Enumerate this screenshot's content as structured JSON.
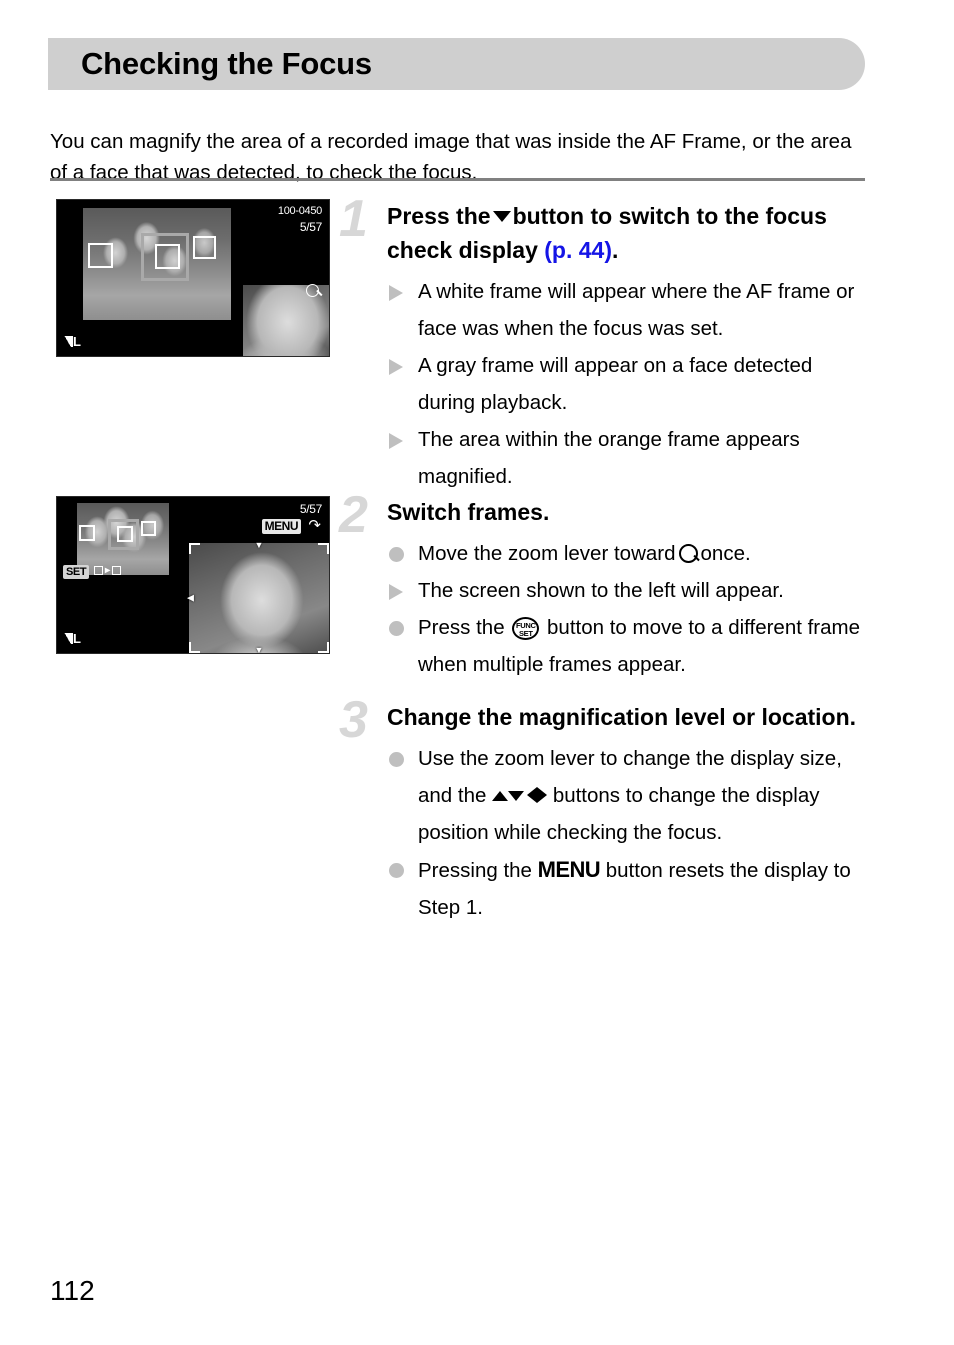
{
  "header": {
    "title": "Checking the Focus",
    "bar_color": "#cfcfcf"
  },
  "intro": {
    "text": "You can magnify the area of a recorded image that was inside the AF Frame, or the area of a face that was detected, to check the focus."
  },
  "figures": {
    "screen1": {
      "file_number": "100-0450",
      "frame_count": "5/57",
      "quality_label": "L",
      "magnify_icon": "magnifier-icon"
    },
    "screen2": {
      "frame_count": "5/57",
      "menu_badge": "MENU",
      "return_icon": "return-arrow-icon",
      "set_badge": "SET",
      "set_action_icon": "frame-to-frame-icon",
      "quality_label": "L"
    }
  },
  "steps": [
    {
      "number": "1",
      "heading_before": "Press the",
      "heading_glyph": "down-arrow-button",
      "heading_mid": "button to switch to the focus check display",
      "heading_link": "(p. 44)",
      "heading_after": ".",
      "bullets": [
        {
          "marker": "triangle",
          "text": "A white frame will appear where the AF frame or face was when the focus was set."
        },
        {
          "marker": "triangle",
          "text": "A gray frame will appear on a face detected during playback."
        },
        {
          "marker": "triangle",
          "text": "The area within the orange frame appears magnified."
        }
      ]
    },
    {
      "number": "2",
      "heading": "Switch frames.",
      "bullets": [
        {
          "marker": "dot",
          "before": "Move the zoom lever toward",
          "glyph": "magnifier-icon",
          "after": "once."
        },
        {
          "marker": "triangle",
          "text": "The screen shown to the left will appear."
        },
        {
          "marker": "dot",
          "before": "Press the",
          "glyph": "func-set-button",
          "after": "button to move to a different frame when multiple frames appear."
        }
      ]
    },
    {
      "number": "3",
      "heading": "Change the magnification level or location.",
      "bullets": [
        {
          "marker": "dot",
          "before": "Use the zoom lever to change the display size, and the",
          "glyph": "direction-buttons",
          "after": "buttons to change the display position while checking the focus."
        },
        {
          "marker": "dot",
          "before": "Pressing the",
          "glyph": "MENU",
          "after": "button resets the display to Step 1."
        }
      ]
    }
  ],
  "footer": {
    "page_number": "112"
  },
  "colors": {
    "link": "#1414e6",
    "step_number": "#d7d7d7",
    "marker": "#bfbfbf",
    "divider": "#808080"
  }
}
